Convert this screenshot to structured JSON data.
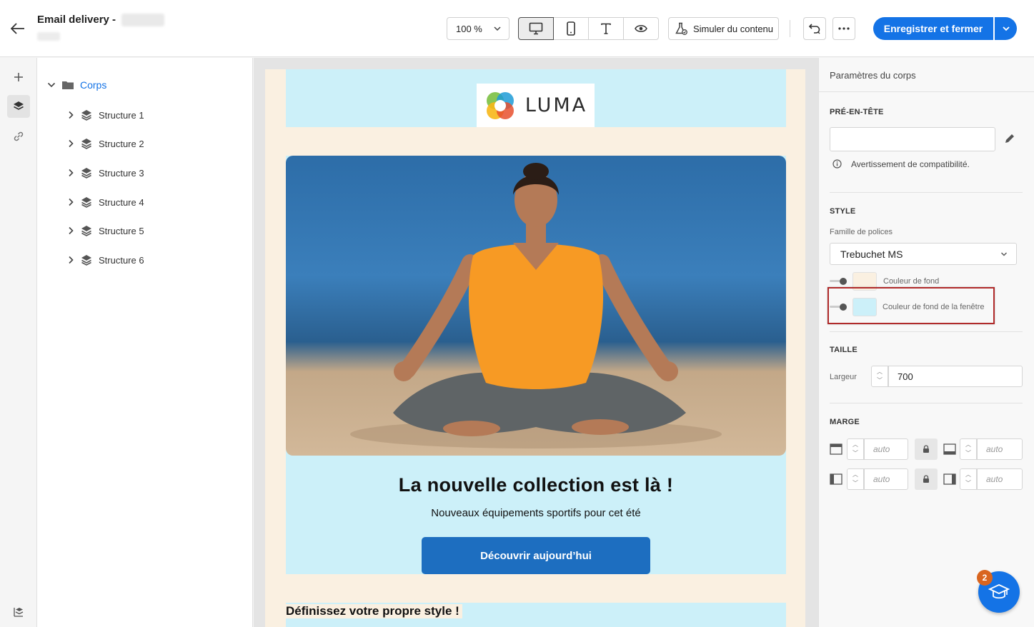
{
  "header": {
    "title": "Email delivery -",
    "zoom": "100 %",
    "simulate_label": "Simuler du contenu",
    "save_label": "Enregistrer et fermer"
  },
  "tree": {
    "root_label": "Corps",
    "items": [
      {
        "label": "Structure 1"
      },
      {
        "label": "Structure 2"
      },
      {
        "label": "Structure 3"
      },
      {
        "label": "Structure 4"
      },
      {
        "label": "Structure 5"
      },
      {
        "label": "Structure 6"
      }
    ]
  },
  "email": {
    "logo_text": "LUMA",
    "headline": "La nouvelle collection est là !",
    "subline": "Nouveaux équipements sportifs pour cet été",
    "cta_label": "Découvrir aujourd’hui",
    "bottom_title": "Définissez votre propre style !",
    "colors": {
      "body_bg": "#faf0e1",
      "window_bg": "#ccf0f9",
      "cta": "#1d6ec0"
    }
  },
  "panel": {
    "title": "Paramètres du corps",
    "preheader_label": "PRÉ-EN-TÊTE",
    "preheader_value": "",
    "compat_warning": "Avertissement de compatibilité.",
    "style_label": "STYLE",
    "font_family_label": "Famille de polices",
    "font_family_value": "Trebuchet MS",
    "bg_color_label": "Couleur de fond",
    "bg_color": "#faf0e1",
    "window_bg_label": "Couleur de fond de la fenêtre",
    "window_bg_color": "#ccf0f9",
    "size_label": "TAILLE",
    "width_label": "Largeur",
    "width_value": "700",
    "margin_label": "MARGE",
    "margin_top": "auto",
    "margin_bottom": "auto",
    "margin_left": "auto",
    "margin_right": "auto"
  },
  "help": {
    "badge_count": "2"
  }
}
